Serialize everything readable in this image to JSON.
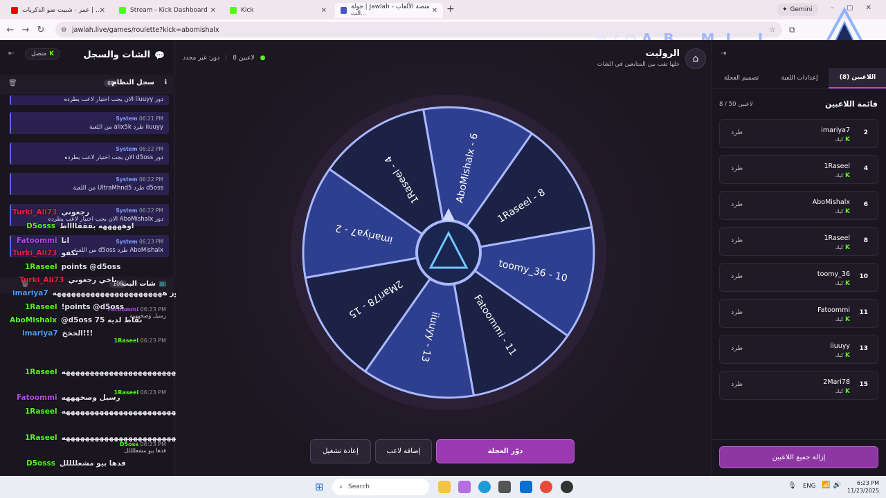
{
  "browser": {
    "tabs": [
      {
        "title": "عمر - شبيت ضو الذكريات | ..."
      },
      {
        "title": "Stream - Kick Dashboard"
      },
      {
        "title": "Kick"
      },
      {
        "title": "جولة | Jawlah - منصة الألعاب الت..."
      }
    ],
    "gemini": "Gemini",
    "url": "jawlah.live/games/roulette?kick=abomishalx"
  },
  "brand": {
    "text": "AB MI L"
  },
  "chat": {
    "title": "الشات والسجل",
    "status": "متصل",
    "syslog_title": "سجل النظام",
    "syslog_count": "88",
    "live_title": "شات البث",
    "live_count": "108",
    "sys_label": "System",
    "syslog": [
      {
        "time": "",
        "msg": "دور iiuuyy الان يجب اختيار لاعب يطرده"
      },
      {
        "time": "06:21 PM",
        "msg": "iiuuyy طرد alix5k من اللعبة"
      },
      {
        "time": "06:22 PM",
        "msg": "دور d5oss الان يجب اختيار لاعب يطرده"
      },
      {
        "time": "06:22 PM",
        "msg": "d5oss طرد UltraMhnd5 من اللعبة"
      },
      {
        "time": "06:22 PM",
        "msg": "دور AboMishalx الان يجب اختيار لاعب يطرده"
      },
      {
        "time": "06:23 PM",
        "msg": "AboMishalx طرد d5oss من اللعبة"
      }
    ],
    "overlay": [
      {
        "user": "Turki_Ali73",
        "color": "#e8243c",
        "text": "رجعوني"
      },
      {
        "user": "D5osss",
        "color": "#53fc18",
        "text": "اوهههههه بقققااااط"
      },
      {
        "user": "Fatoommi",
        "color": "#b44bea",
        "text": "انا"
      },
      {
        "user": "Turki_Ali73",
        "color": "#e8243c",
        "text": "تكفو"
      },
      {
        "user": "1Raseel",
        "color": "#53fc18",
        "text": "points @d5oss"
      },
      {
        "user": "Turki_Ali73",
        "color": "#e8243c",
        "text": "ياخي رجعوني"
      },
      {
        "user": "imariya7",
        "color": "#4a9eff",
        "text": "عزوز هههههههههههههههههههههههه"
      },
      {
        "user": "1Raseel",
        "color": "#53fc18",
        "text": "!points @d5oss"
      },
      {
        "user": "AboMishalx",
        "color": "#53fc18",
        "text": "@d5oss 75 نقاط لديه"
      },
      {
        "user": "imariya7",
        "color": "#4a9eff",
        "text": "الخخخ!!!"
      },
      {
        "user": "1Raseel",
        "color": "#53fc18",
        "text": "ههههههههههههههههههههههههههههههههههه"
      },
      {
        "user": "Fatoommi",
        "color": "#b44bea",
        "text": "رسيل وصخهههه"
      },
      {
        "user": "1Raseel",
        "color": "#53fc18",
        "text": "ههههههههههههههههههههههههههههههههههه"
      },
      {
        "user": "1Raseel",
        "color": "#53fc18",
        "text": "ههههههههههههههههههههههههههههههههههه"
      },
      {
        "user": "D5osss",
        "color": "#53fc18",
        "text": "قدها بيو مشعللللل"
      }
    ],
    "live_meta": [
      {
        "user": "Fatoommi",
        "time": "06:23 PM",
        "text": "رسيل وصخهههه"
      },
      {
        "user": "1Raseel",
        "time": "06:23 PM",
        "text": ""
      },
      {
        "user": "1Raseel",
        "time": "06:23 PM",
        "text": ""
      },
      {
        "user": "D5oss",
        "time": "06:23 PM",
        "text": "قدها بيو مشعللللل"
      }
    ]
  },
  "game": {
    "title": "الروليت",
    "subtitle": "خلها تقب بين المتابعين في الشات",
    "players_count": "8 لاعبين",
    "turn": "دور: غير محدد",
    "wheel_segments": [
      "AboMishalx - 6",
      "1Raseel - 8",
      "toomy_36 - 10",
      "Fatoommi - 11",
      "iiuuyy - 13",
      "2Mari78 - 15",
      "imariya7 - 2",
      "1Raseel - 4"
    ],
    "spin_button": "دوّر العجلة",
    "add_button": "إضافة لاعب",
    "restart_button": "إعادة تشغيل"
  },
  "players_panel": {
    "tabs": [
      "اللاعبين (8)",
      "إعدادات اللعبة",
      "تصميم العجلة"
    ],
    "title": "قائمة اللاعبين",
    "count": "8 / 50 لاعبين",
    "kick_label": "طرد",
    "source": "كيك",
    "players": [
      {
        "num": "2",
        "name": "imariya7"
      },
      {
        "num": "4",
        "name": "1Raseel"
      },
      {
        "num": "6",
        "name": "AboMishalx"
      },
      {
        "num": "8",
        "name": "1Raseel"
      },
      {
        "num": "10",
        "name": "toomy_36"
      },
      {
        "num": "11",
        "name": "Fatoommi"
      },
      {
        "num": "13",
        "name": "iiuuyy"
      },
      {
        "num": "15",
        "name": "2Mari78"
      }
    ],
    "remove_all": "إزالة جميع اللاعبين"
  },
  "taskbar": {
    "search": "Search",
    "lang": "ENG",
    "time": "6:23 PM",
    "date": "11/23/2025"
  }
}
